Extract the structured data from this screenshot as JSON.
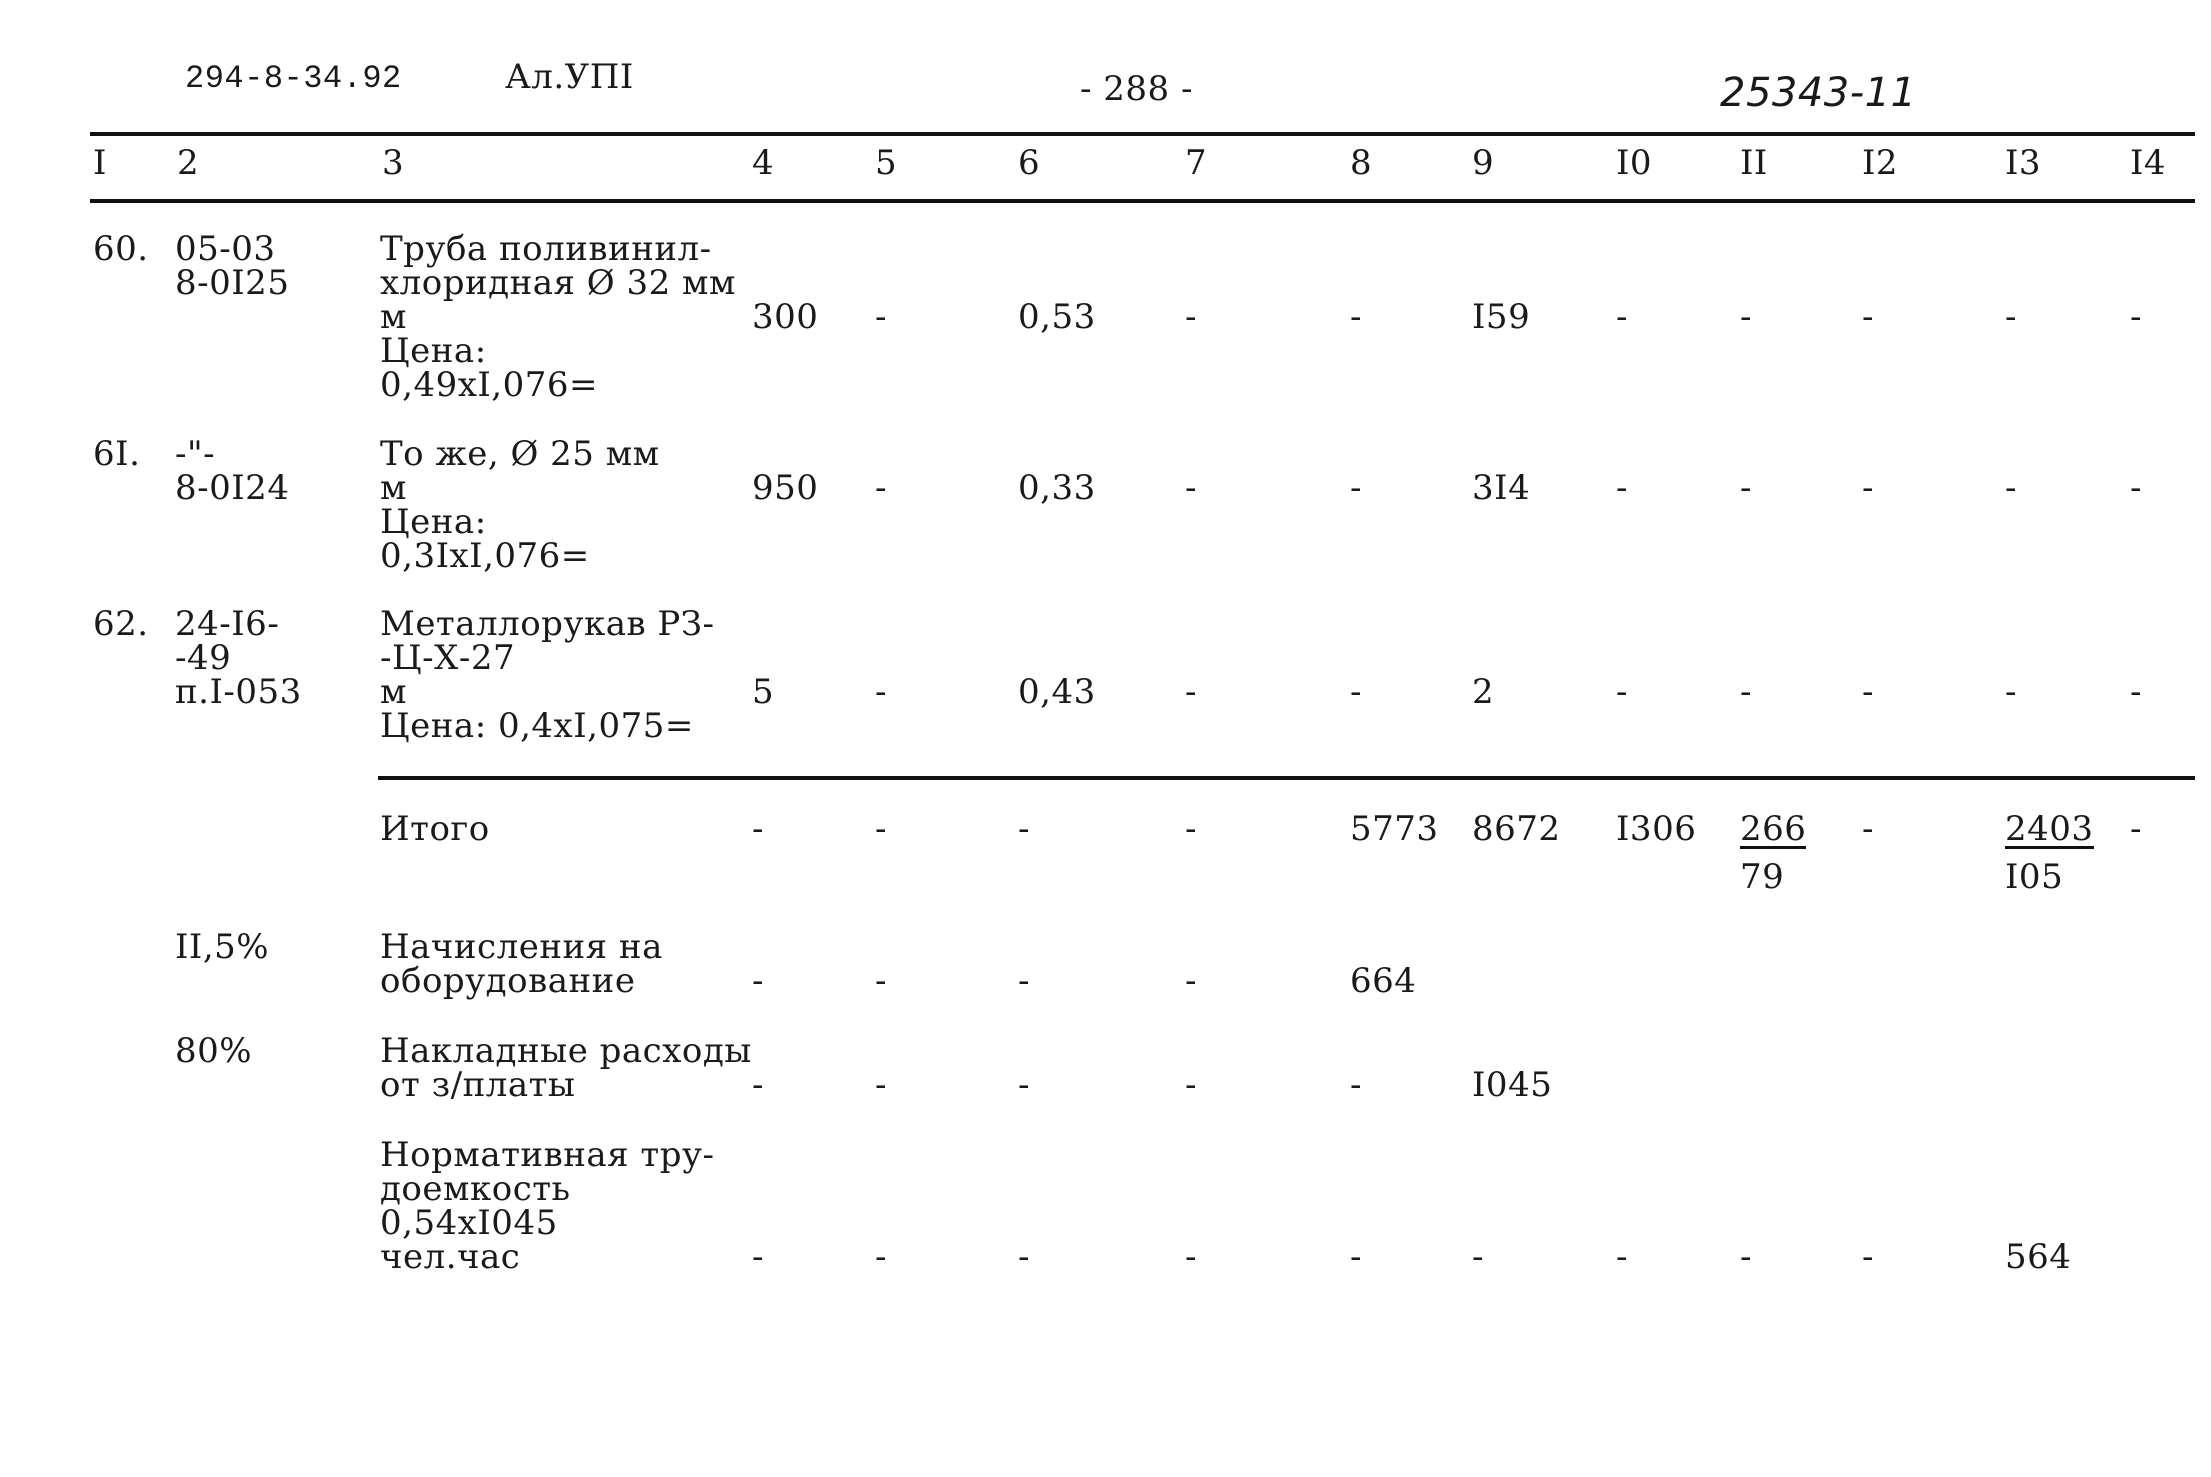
{
  "header": {
    "doc_code": "294-8-34.92",
    "album": "Ал.УПI",
    "page": "- 288 -",
    "handwritten_ref": "25343-11"
  },
  "columns": [
    "I",
    "2",
    "3",
    "4",
    "5",
    "6",
    "7",
    "8",
    "9",
    "I0",
    "II",
    "I2",
    "I3",
    "I4"
  ],
  "rows": [
    {
      "num": "60.",
      "code": [
        "05-03",
        "8-0I25"
      ],
      "desc": [
        "Труба поливинил-",
        "хлоридная Ø 32 мм",
        "м",
        "Цена:",
        "0,49xI,076="
      ],
      "values": [
        "300",
        "-",
        "0,53",
        "-",
        "-",
        "I59",
        "-",
        "-",
        "-",
        "-",
        "-"
      ]
    },
    {
      "num": "6I.",
      "code": [
        "-\"-",
        "8-0I24"
      ],
      "desc": [
        "То же, Ø 25 мм",
        "м",
        "Цена:",
        "0,3IxI,076="
      ],
      "values": [
        "950",
        "-",
        "0,33",
        "-",
        "-",
        "3I4",
        "-",
        "-",
        "-",
        "-",
        "-"
      ]
    },
    {
      "num": "62.",
      "code": [
        "24-I6-",
        "-49",
        "п.I-053"
      ],
      "desc": [
        "Металлорукав РЗ-",
        "-Ц-Х-27",
        "м",
        "Цена: 0,4xI,075="
      ],
      "values": [
        "5",
        "-",
        "0,43",
        "-",
        "-",
        "2",
        "-",
        "-",
        "-",
        "-",
        "-"
      ]
    }
  ],
  "total": {
    "label": "Итого",
    "values": [
      "-",
      "-",
      "-",
      "-",
      "5773",
      "8672",
      "I306",
      "266",
      "-",
      "2403",
      "-"
    ],
    "sub_values": {
      "c11": "79",
      "c13": "I05"
    }
  },
  "extras": [
    {
      "pct": "II,5%",
      "desc": [
        "Начисления на",
        "оборудование"
      ],
      "values": [
        "-",
        "-",
        "-",
        "-",
        "664"
      ]
    },
    {
      "pct": "80%",
      "desc": [
        "Накладные расходы",
        "от з/платы"
      ],
      "values": [
        "-",
        "-",
        "-",
        "-",
        "-",
        "I045"
      ]
    },
    {
      "pct": "",
      "desc": [
        "Нормативная тру-",
        "доемкость",
        "0,54xI045",
        "чел.час"
      ],
      "values": [
        "-",
        "-",
        "-",
        "-",
        "-",
        "-",
        "-",
        "-",
        "-",
        "564"
      ]
    }
  ]
}
